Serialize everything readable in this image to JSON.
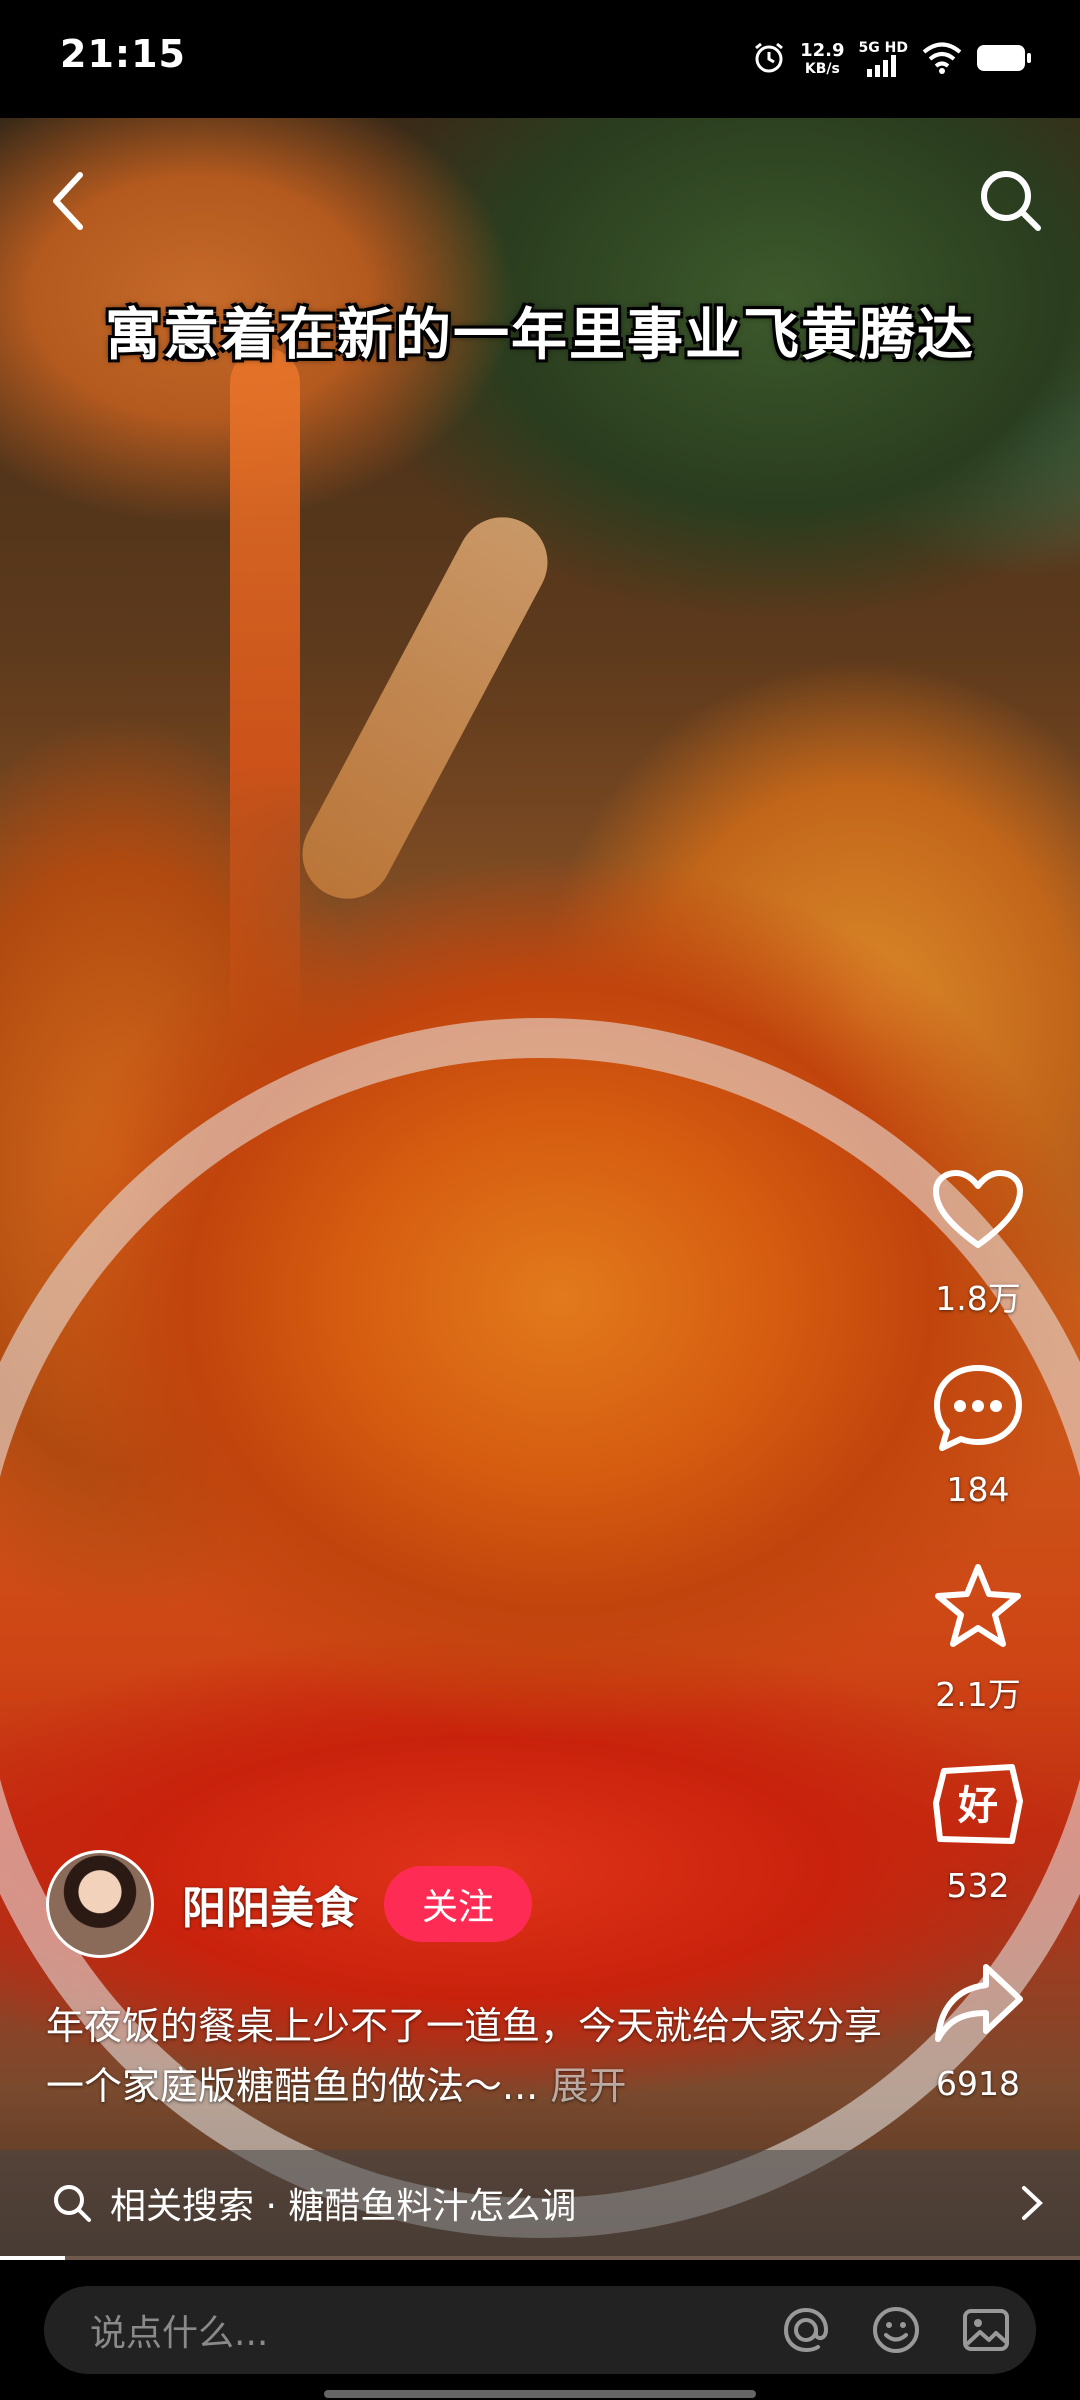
{
  "status_bar": {
    "time": "21:15",
    "speed_value": "12.9",
    "speed_unit": "KB/s",
    "network": "5G HD",
    "icons": [
      "alarm-icon",
      "signal-icon",
      "wifi-icon",
      "battery-icon"
    ]
  },
  "video": {
    "caption": "寓意着在新的一年里事业飞黄腾达"
  },
  "actions": {
    "like": "1.8万",
    "comment": "184",
    "favorite": "2.1万",
    "rating": "532",
    "share": "6918"
  },
  "author": {
    "name": "阳阳美食",
    "follow_label": "关注"
  },
  "description": {
    "text": "年夜饭的餐桌上少不了一道鱼，今天就给大家分享一个家庭版糖醋鱼的做法～...",
    "more_label": "展开"
  },
  "related_search": {
    "text": "相关搜索 · 糖醋鱼料汁怎么调"
  },
  "progress": {
    "fraction": 0.06
  },
  "comment_bar": {
    "placeholder": "说点什么..."
  },
  "colors": {
    "follow_button": "#fe2c55",
    "background": "#000000"
  }
}
